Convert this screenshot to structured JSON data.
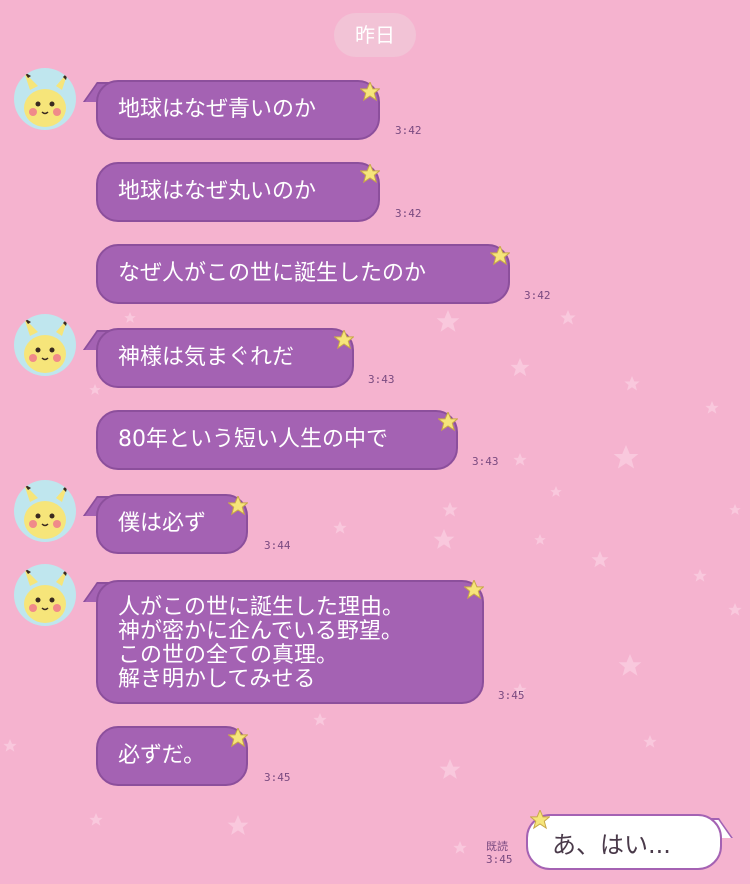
{
  "date_separator": "昨日",
  "messages": [
    {
      "text": "地球はなぜ青いのか",
      "time": "3:42"
    },
    {
      "text": "地球はなぜ丸いのか",
      "time": "3:42"
    },
    {
      "text": "なぜ人がこの世に誕生したのか",
      "time": "3:42"
    },
    {
      "text": "神様は気まぐれだ",
      "time": "3:43"
    },
    {
      "text": "80年という短い人生の中で",
      "time": "3:43"
    },
    {
      "text": "僕は必ず",
      "time": "3:44"
    },
    {
      "text": "人がこの世に誕生した理由。\n神が密かに企んでいる野望。\nこの世の全ての真理。\n解き明かしてみせる",
      "time": "3:45"
    },
    {
      "text": "必ずだ。",
      "time": "3:45"
    }
  ],
  "reply": {
    "text": "あ、はい...",
    "read_label": "既読",
    "time": "3:45"
  },
  "colors": {
    "background": "#f5b3cf",
    "bubble": "#a462b3",
    "bubble_border": "#8c4f9c",
    "avatar_bg": "#bfe6ee"
  },
  "icons": {
    "avatar": "pikachu-avatar-icon",
    "star": "star-icon"
  }
}
